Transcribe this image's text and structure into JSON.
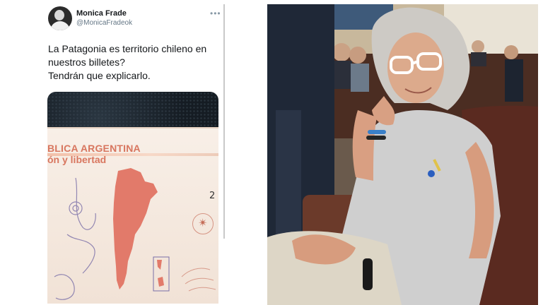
{
  "tweet": {
    "author_name": "Monica Frade",
    "author_handle": "@MonicaFradeok",
    "more_icon": "more-horizontal-icon",
    "text_lines": [
      "La Patagonia es territorio chileno en",
      "nuestros billetes?",
      "Tendrán que explicarlo."
    ]
  },
  "banknote": {
    "line1": "BLICA ARGENTINA",
    "line2": "ón y libertad",
    "denomination": "2",
    "compass_icon": "compass-rose-icon"
  },
  "colors": {
    "text": "#14171a",
    "handle": "#657786",
    "note_text": "#d8765f",
    "map_fill": "#e27a6a"
  }
}
